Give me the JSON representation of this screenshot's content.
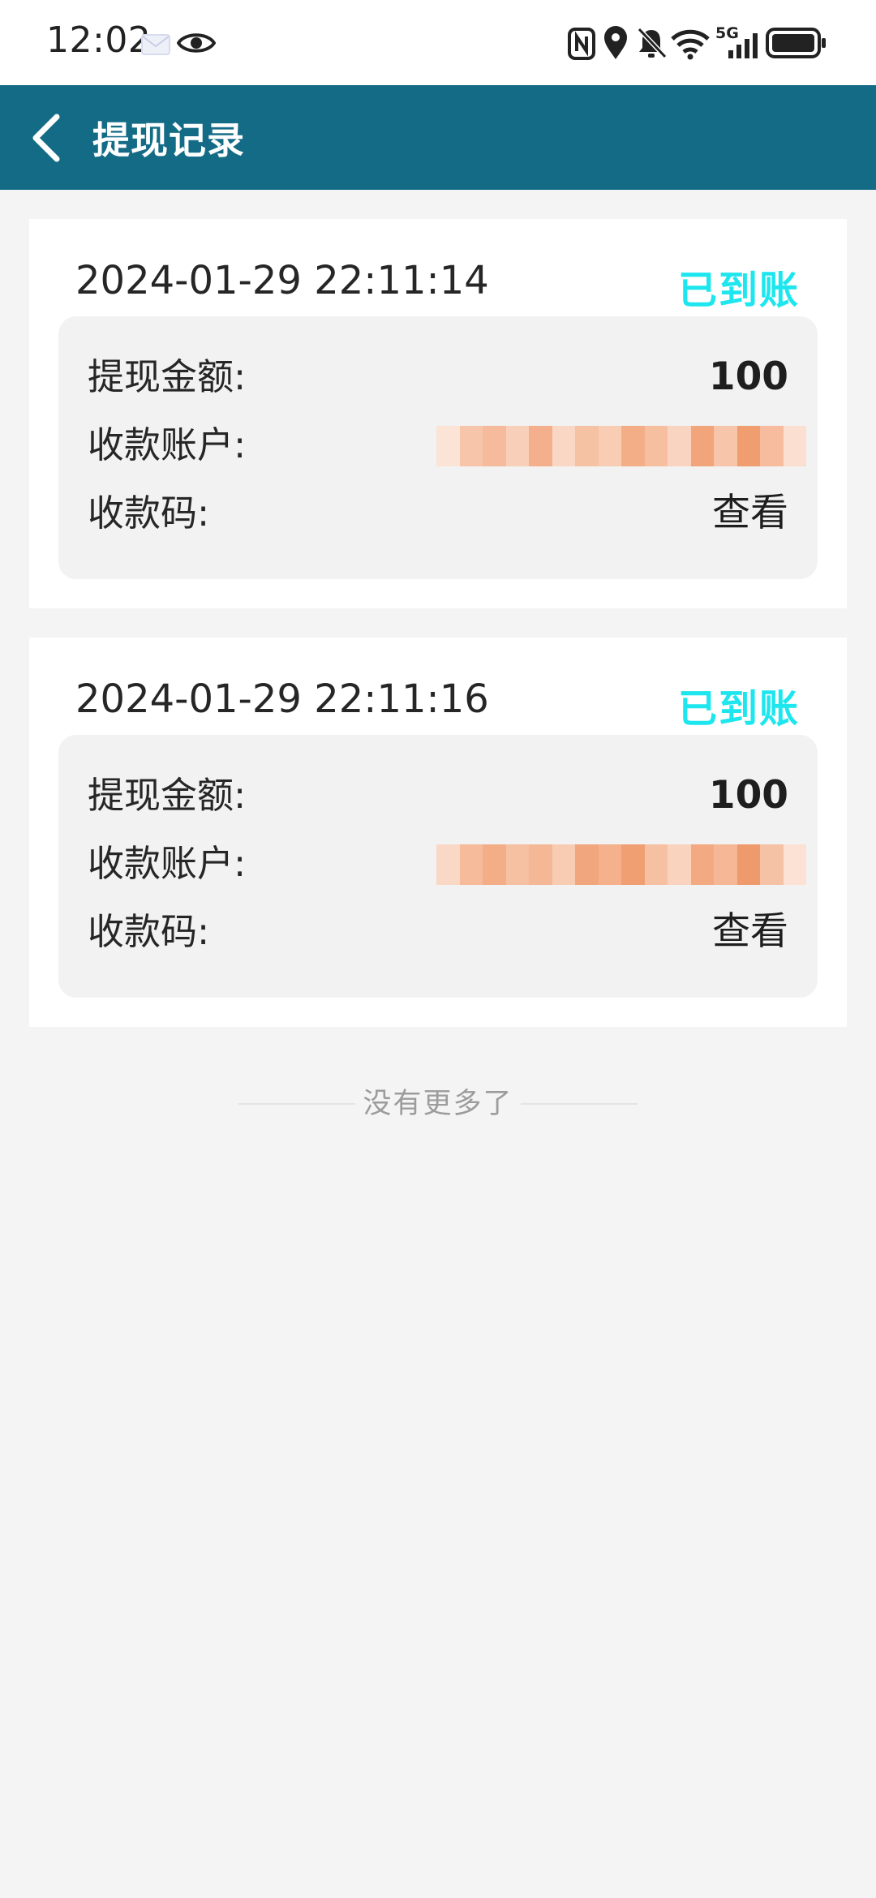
{
  "status_bar": {
    "time": "12:02",
    "network_label": "5G"
  },
  "header": {
    "title": "提现记录"
  },
  "records": [
    {
      "date": "2024-01-29 22:11:14",
      "status": "已到账",
      "amount_label": "提现金额:",
      "amount": "100",
      "account_label": "收款账户:",
      "code_label": "收款码:",
      "code_action": "查看"
    },
    {
      "date": "2024-01-29 22:11:16",
      "status": "已到账",
      "amount_label": "提现金额:",
      "amount": "100",
      "account_label": "收款账户:",
      "code_label": "收款码:",
      "code_action": "查看"
    }
  ],
  "footer": {
    "end_text": "没有更多了"
  },
  "colors": {
    "header_bg": "#136b86",
    "status_arrived": "#1ee6ee",
    "page_bg": "#f4f4f4"
  },
  "icons": [
    "mail-icon",
    "eye-icon",
    "nfc-icon",
    "location-icon",
    "bell-off-icon",
    "wifi-icon",
    "signal-icon",
    "battery-icon",
    "back-arrow-icon"
  ]
}
